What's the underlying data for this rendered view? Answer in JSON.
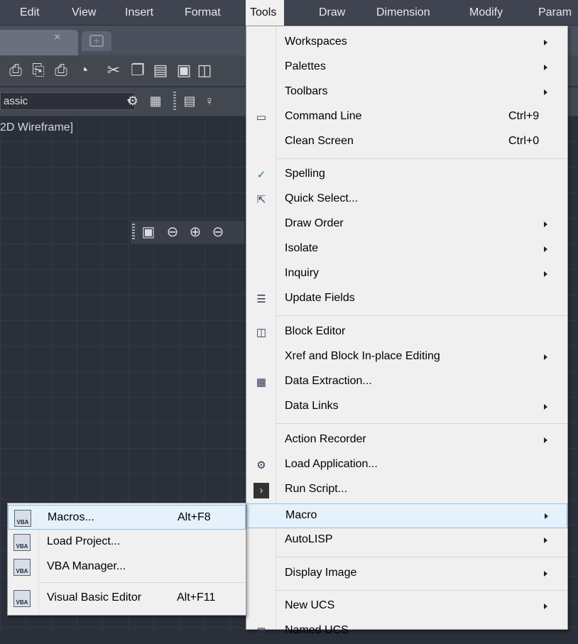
{
  "menubar": {
    "items": [
      "Edit",
      "View",
      "Insert",
      "Format",
      "Tools",
      "Draw",
      "Dimension",
      "Modify",
      "Param"
    ],
    "active": "Tools"
  },
  "tabs": {
    "close_glyph": "×",
    "new_tab_glyph": "+"
  },
  "toolbar": {
    "icons": [
      "plot-icon",
      "plot-preview-icon",
      "publish-icon",
      "3d-print-icon",
      "cut-icon",
      "copy-icon",
      "paste-icon",
      "match-properties-icon",
      "block-editor-icon"
    ]
  },
  "workspace": {
    "value": "assic",
    "layer_icons": [
      "settings-icon",
      "layer-properties-icon",
      "layer-state-icon",
      "bulb-icon"
    ]
  },
  "viewport": {
    "label": "2D Wireframe]"
  },
  "floating_toolbar": {
    "icons": [
      "ucs-cube-icon",
      "orbit-icon",
      "orbit-add-icon",
      "orbit-remove-icon"
    ]
  },
  "tools_menu": {
    "items": [
      {
        "label": "Workspaces",
        "shortcut": "",
        "submenu": true,
        "icon": ""
      },
      {
        "label": "Palettes",
        "shortcut": "",
        "submenu": true,
        "icon": ""
      },
      {
        "label": "Toolbars",
        "shortcut": "",
        "submenu": true,
        "icon": ""
      },
      {
        "label": "Command Line",
        "shortcut": "Ctrl+9",
        "submenu": false,
        "icon": "command-line-icon"
      },
      {
        "label": "Clean Screen",
        "shortcut": "Ctrl+0",
        "submenu": false,
        "icon": ""
      },
      {
        "label": "Spelling",
        "shortcut": "",
        "submenu": false,
        "icon": "spelling-icon"
      },
      {
        "label": "Quick Select...",
        "shortcut": "",
        "submenu": false,
        "icon": "quick-select-icon"
      },
      {
        "label": "Draw Order",
        "shortcut": "",
        "submenu": true,
        "icon": ""
      },
      {
        "label": "Isolate",
        "shortcut": "",
        "submenu": true,
        "icon": ""
      },
      {
        "label": "Inquiry",
        "shortcut": "",
        "submenu": true,
        "icon": ""
      },
      {
        "label": "Update Fields",
        "shortcut": "",
        "submenu": false,
        "icon": "update-fields-icon"
      },
      {
        "label": "Block Editor",
        "shortcut": "",
        "submenu": false,
        "icon": "block-editor-icon"
      },
      {
        "label": "Xref and Block In-place Editing",
        "shortcut": "",
        "submenu": true,
        "icon": ""
      },
      {
        "label": "Data Extraction...",
        "shortcut": "",
        "submenu": false,
        "icon": "data-extraction-icon"
      },
      {
        "label": "Data Links",
        "shortcut": "",
        "submenu": true,
        "icon": ""
      },
      {
        "label": "Action Recorder",
        "shortcut": "",
        "submenu": true,
        "icon": ""
      },
      {
        "label": "Load Application...",
        "shortcut": "",
        "submenu": false,
        "icon": "load-application-icon"
      },
      {
        "label": "Run Script...",
        "shortcut": "",
        "submenu": false,
        "icon": "run-script-icon"
      },
      {
        "label": "Macro",
        "shortcut": "",
        "submenu": true,
        "icon": "",
        "highlighted": true
      },
      {
        "label": "AutoLISP",
        "shortcut": "",
        "submenu": true,
        "icon": ""
      },
      {
        "label": "Display Image",
        "shortcut": "",
        "submenu": true,
        "icon": ""
      },
      {
        "label": "New UCS",
        "shortcut": "",
        "submenu": true,
        "icon": ""
      },
      {
        "label": "Named UCS",
        "shortcut": "",
        "submenu": false,
        "icon": "named-ucs-icon"
      }
    ]
  },
  "macro_submenu": {
    "items": [
      {
        "label": "Macros...",
        "shortcut": "Alt+F8",
        "icon": "vba-macros-icon",
        "icon_text": "VBA"
      },
      {
        "label": "Load Project...",
        "shortcut": "",
        "icon": "vba-load-project-icon",
        "icon_text": "VBA"
      },
      {
        "label": "VBA Manager...",
        "shortcut": "",
        "icon": "vba-manager-icon",
        "icon_text": "VBA"
      },
      {
        "label": "Visual Basic Editor",
        "shortcut": "Alt+F11",
        "icon": "visual-basic-editor-icon",
        "icon_text": "VBA"
      }
    ]
  },
  "colors": {
    "menu_bg": "#f0f0f0",
    "highlight": "#e5f1fb",
    "highlight_border": "#8fbce6",
    "app_dark": "#2a2f3a"
  }
}
